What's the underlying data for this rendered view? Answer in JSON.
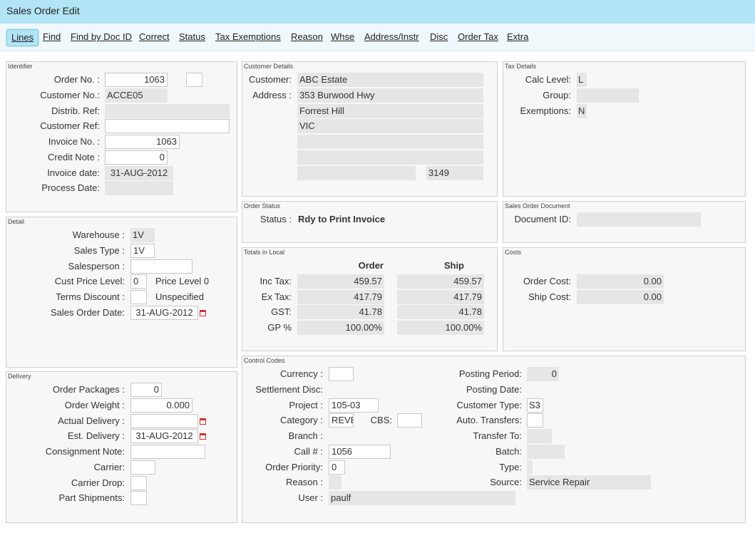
{
  "window": {
    "title": "Sales Order Edit"
  },
  "toolbar": [
    {
      "label": "Lines"
    },
    {
      "label": "Find"
    },
    {
      "label": "Find by Doc ID"
    },
    {
      "label": "Correct"
    },
    {
      "label": "Status"
    },
    {
      "label": "Tax Exemptions"
    },
    {
      "label": "Reason"
    },
    {
      "label": "Whse"
    },
    {
      "label": "Address/Instr"
    },
    {
      "label": "Disc"
    },
    {
      "label": "Order Tax"
    },
    {
      "label": "Extra"
    }
  ],
  "identifier": {
    "title": "Identifier",
    "order_no_label": "Order No. :",
    "order_no": "1063",
    "customer_no_label": "Customer No.:",
    "customer_no": "ACCE05",
    "distrib_ref_label": "Distrib. Ref:",
    "distrib_ref": "",
    "customer_ref_label": "Customer Ref:",
    "customer_ref": "",
    "invoice_no_label": "Invoice No. :",
    "invoice_no": "1063",
    "credit_note_label": "Credit Note :",
    "credit_note": "0",
    "invoice_date_label": "Invoice date:",
    "invoice_date": "31-AUG-2012",
    "process_date_label": "Process Date:",
    "process_date": ""
  },
  "customer": {
    "title": "Customer Details",
    "customer_label": "Customer:",
    "customer": "ABC Estate",
    "address_label": "Address :",
    "address": [
      "353 Burwood Hwy",
      "Forrest Hill",
      "VIC",
      "",
      "",
      ""
    ],
    "postcode": "3149"
  },
  "tax": {
    "title": "Tax Details",
    "calc_level_label": "Calc Level:",
    "calc_level": "L",
    "group_label": "Group:",
    "group": "",
    "exemptions_label": "Exemptions:",
    "exemptions": "N"
  },
  "detail": {
    "title": "Detail",
    "warehouse_label": "Warehouse :",
    "warehouse": "1V",
    "sales_type_label": "Sales Type :",
    "sales_type": "1V",
    "salesperson_label": "Salesperson :",
    "salesperson": "",
    "cust_price_level_label": "Cust Price Level:",
    "cust_price_level": "0",
    "price_level_desc": "Price Level 0",
    "terms_discount_label": "Terms Discount :",
    "terms_discount": "",
    "terms_desc": "Unspecified",
    "sales_order_date_label": "Sales Order Date:",
    "sales_order_date": "31-AUG-2012"
  },
  "order_status": {
    "title": "Order Status",
    "status_label": "Status :",
    "status": "Rdy to Print Invoice"
  },
  "sales_doc": {
    "title": "Sales Order Document",
    "doc_id_label": "Document ID:",
    "doc_id": ""
  },
  "totals": {
    "title": "Totals in Local",
    "col_order": "Order",
    "col_ship": "Ship",
    "rows": [
      {
        "label": "Inc Tax:",
        "order": "459.57",
        "ship": "459.57"
      },
      {
        "label": "Ex Tax:",
        "order": "417.79",
        "ship": "417.79"
      },
      {
        "label": "GST:",
        "order": "41.78",
        "ship": "41.78"
      },
      {
        "label": "GP %",
        "order": "100.00%",
        "ship": "100.00%"
      }
    ]
  },
  "costs": {
    "title": "Costs",
    "order_cost_label": "Order Cost:",
    "order_cost": "0.00",
    "ship_cost_label": "Ship Cost:",
    "ship_cost": "0.00"
  },
  "delivery": {
    "title": "Delivery",
    "order_packages_label": "Order Packages :",
    "order_packages": "0",
    "order_weight_label": "Order Weight :",
    "order_weight": "0.000",
    "actual_delivery_label": "Actual Delivery :",
    "actual_delivery": "",
    "est_delivery_label": "Est. Delivery :",
    "est_delivery": "31-AUG-2012",
    "consignment_label": "Consignment Note:",
    "consignment": "",
    "carrier_label": "Carrier:",
    "carrier": "",
    "carrier_drop_label": "Carrier Drop:",
    "carrier_drop": "",
    "part_shipments_label": "Part Shipments:",
    "part_shipments": ""
  },
  "control": {
    "title": "Control Codes",
    "currency_label": "Currency :",
    "currency": "",
    "settlement_label": "Settlement Disc:",
    "project_label": "Project :",
    "project": "105-03",
    "category_label": "Category :",
    "category": "REVB",
    "cbs_label": "CBS:",
    "cbs": "",
    "branch_label": "Branch :",
    "call_label": "Call # :",
    "call": "1056",
    "priority_label": "Order Priority:",
    "priority": "0",
    "reason_label": "Reason :",
    "reason": "",
    "user_label": "User :",
    "user": "paulf",
    "posting_period_label": "Posting Period:",
    "posting_period": "0",
    "posting_date_label": "Posting Date:",
    "customer_type_label": "Customer Type:",
    "customer_type": "S3",
    "auto_transfers_label": "Auto. Transfers:",
    "auto_transfers": "",
    "transfer_to_label": "Transfer To:",
    "transfer_to": "",
    "batch_label": "Batch:",
    "batch": "",
    "type_label": "Type:",
    "type": "",
    "source_label": "Source:",
    "source": "Service Repair"
  }
}
